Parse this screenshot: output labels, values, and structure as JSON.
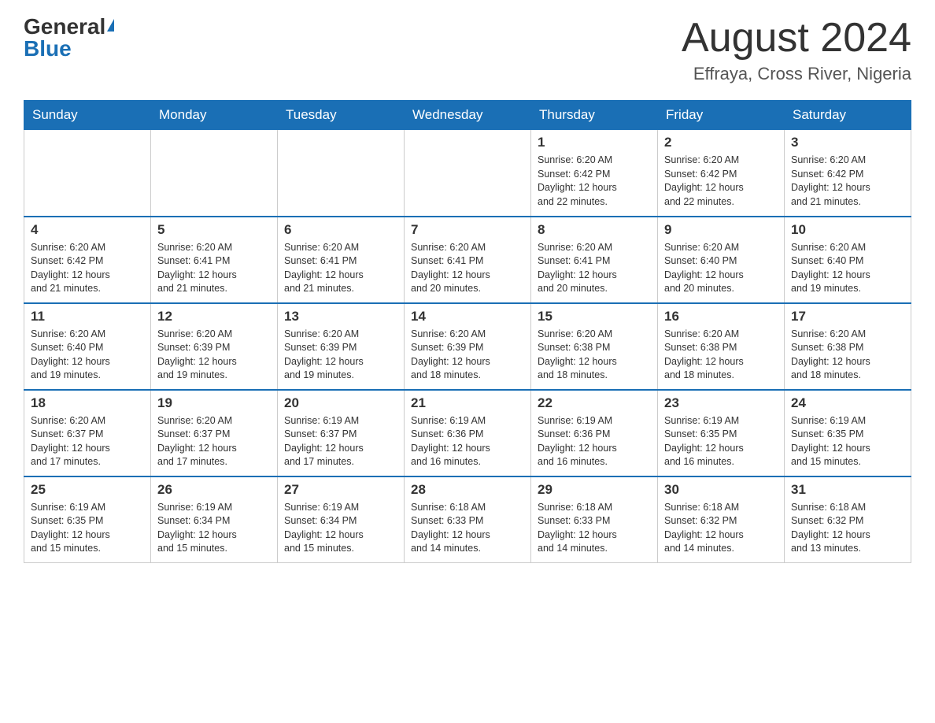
{
  "header": {
    "logo_general": "General",
    "logo_blue": "Blue",
    "month_title": "August 2024",
    "location": "Effraya, Cross River, Nigeria"
  },
  "calendar": {
    "days_of_week": [
      "Sunday",
      "Monday",
      "Tuesday",
      "Wednesday",
      "Thursday",
      "Friday",
      "Saturday"
    ],
    "weeks": [
      [
        {
          "day": "",
          "info": ""
        },
        {
          "day": "",
          "info": ""
        },
        {
          "day": "",
          "info": ""
        },
        {
          "day": "",
          "info": ""
        },
        {
          "day": "1",
          "info": "Sunrise: 6:20 AM\nSunset: 6:42 PM\nDaylight: 12 hours\nand 22 minutes."
        },
        {
          "day": "2",
          "info": "Sunrise: 6:20 AM\nSunset: 6:42 PM\nDaylight: 12 hours\nand 22 minutes."
        },
        {
          "day": "3",
          "info": "Sunrise: 6:20 AM\nSunset: 6:42 PM\nDaylight: 12 hours\nand 21 minutes."
        }
      ],
      [
        {
          "day": "4",
          "info": "Sunrise: 6:20 AM\nSunset: 6:42 PM\nDaylight: 12 hours\nand 21 minutes."
        },
        {
          "day": "5",
          "info": "Sunrise: 6:20 AM\nSunset: 6:41 PM\nDaylight: 12 hours\nand 21 minutes."
        },
        {
          "day": "6",
          "info": "Sunrise: 6:20 AM\nSunset: 6:41 PM\nDaylight: 12 hours\nand 21 minutes."
        },
        {
          "day": "7",
          "info": "Sunrise: 6:20 AM\nSunset: 6:41 PM\nDaylight: 12 hours\nand 20 minutes."
        },
        {
          "day": "8",
          "info": "Sunrise: 6:20 AM\nSunset: 6:41 PM\nDaylight: 12 hours\nand 20 minutes."
        },
        {
          "day": "9",
          "info": "Sunrise: 6:20 AM\nSunset: 6:40 PM\nDaylight: 12 hours\nand 20 minutes."
        },
        {
          "day": "10",
          "info": "Sunrise: 6:20 AM\nSunset: 6:40 PM\nDaylight: 12 hours\nand 19 minutes."
        }
      ],
      [
        {
          "day": "11",
          "info": "Sunrise: 6:20 AM\nSunset: 6:40 PM\nDaylight: 12 hours\nand 19 minutes."
        },
        {
          "day": "12",
          "info": "Sunrise: 6:20 AM\nSunset: 6:39 PM\nDaylight: 12 hours\nand 19 minutes."
        },
        {
          "day": "13",
          "info": "Sunrise: 6:20 AM\nSunset: 6:39 PM\nDaylight: 12 hours\nand 19 minutes."
        },
        {
          "day": "14",
          "info": "Sunrise: 6:20 AM\nSunset: 6:39 PM\nDaylight: 12 hours\nand 18 minutes."
        },
        {
          "day": "15",
          "info": "Sunrise: 6:20 AM\nSunset: 6:38 PM\nDaylight: 12 hours\nand 18 minutes."
        },
        {
          "day": "16",
          "info": "Sunrise: 6:20 AM\nSunset: 6:38 PM\nDaylight: 12 hours\nand 18 minutes."
        },
        {
          "day": "17",
          "info": "Sunrise: 6:20 AM\nSunset: 6:38 PM\nDaylight: 12 hours\nand 18 minutes."
        }
      ],
      [
        {
          "day": "18",
          "info": "Sunrise: 6:20 AM\nSunset: 6:37 PM\nDaylight: 12 hours\nand 17 minutes."
        },
        {
          "day": "19",
          "info": "Sunrise: 6:20 AM\nSunset: 6:37 PM\nDaylight: 12 hours\nand 17 minutes."
        },
        {
          "day": "20",
          "info": "Sunrise: 6:19 AM\nSunset: 6:37 PM\nDaylight: 12 hours\nand 17 minutes."
        },
        {
          "day": "21",
          "info": "Sunrise: 6:19 AM\nSunset: 6:36 PM\nDaylight: 12 hours\nand 16 minutes."
        },
        {
          "day": "22",
          "info": "Sunrise: 6:19 AM\nSunset: 6:36 PM\nDaylight: 12 hours\nand 16 minutes."
        },
        {
          "day": "23",
          "info": "Sunrise: 6:19 AM\nSunset: 6:35 PM\nDaylight: 12 hours\nand 16 minutes."
        },
        {
          "day": "24",
          "info": "Sunrise: 6:19 AM\nSunset: 6:35 PM\nDaylight: 12 hours\nand 15 minutes."
        }
      ],
      [
        {
          "day": "25",
          "info": "Sunrise: 6:19 AM\nSunset: 6:35 PM\nDaylight: 12 hours\nand 15 minutes."
        },
        {
          "day": "26",
          "info": "Sunrise: 6:19 AM\nSunset: 6:34 PM\nDaylight: 12 hours\nand 15 minutes."
        },
        {
          "day": "27",
          "info": "Sunrise: 6:19 AM\nSunset: 6:34 PM\nDaylight: 12 hours\nand 15 minutes."
        },
        {
          "day": "28",
          "info": "Sunrise: 6:18 AM\nSunset: 6:33 PM\nDaylight: 12 hours\nand 14 minutes."
        },
        {
          "day": "29",
          "info": "Sunrise: 6:18 AM\nSunset: 6:33 PM\nDaylight: 12 hours\nand 14 minutes."
        },
        {
          "day": "30",
          "info": "Sunrise: 6:18 AM\nSunset: 6:32 PM\nDaylight: 12 hours\nand 14 minutes."
        },
        {
          "day": "31",
          "info": "Sunrise: 6:18 AM\nSunset: 6:32 PM\nDaylight: 12 hours\nand 13 minutes."
        }
      ]
    ]
  }
}
